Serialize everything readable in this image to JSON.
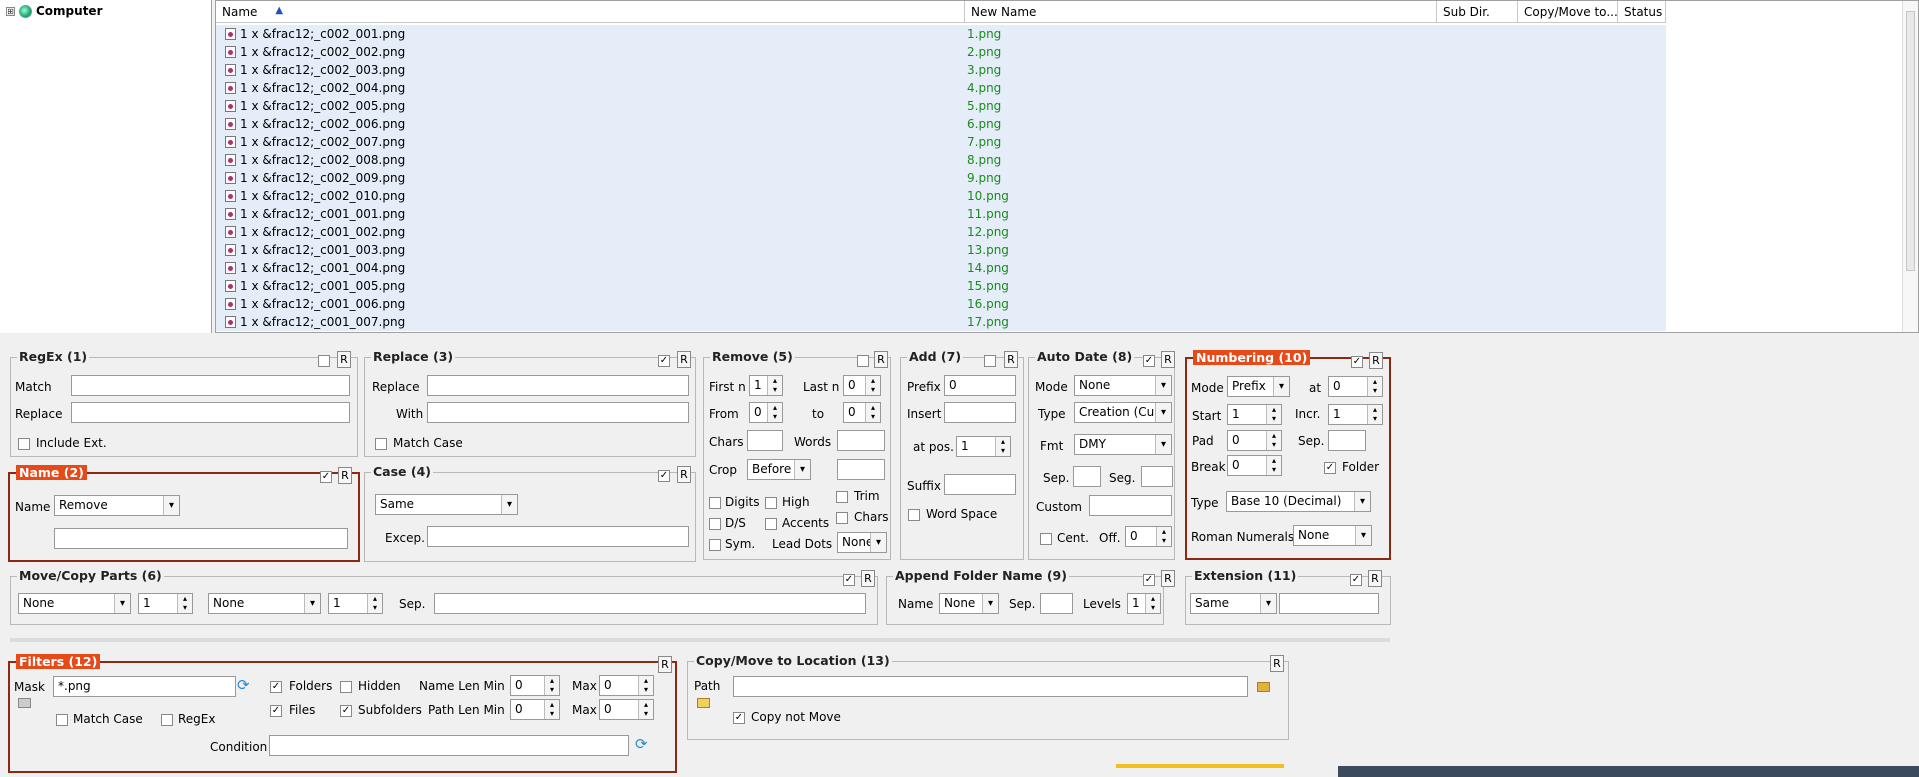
{
  "tree": {
    "root_label": "Computer",
    "expander": "⊞"
  },
  "columns": [
    "Name",
    "New Name",
    "Sub Dir.",
    "Copy/Move to...",
    "Status"
  ],
  "files": [
    {
      "name": "1 x &frac12;_c002_001.png",
      "new": "1.png"
    },
    {
      "name": "1 x &frac12;_c002_002.png",
      "new": "2.png"
    },
    {
      "name": "1 x &frac12;_c002_003.png",
      "new": "3.png"
    },
    {
      "name": "1 x &frac12;_c002_004.png",
      "new": "4.png"
    },
    {
      "name": "1 x &frac12;_c002_005.png",
      "new": "5.png"
    },
    {
      "name": "1 x &frac12;_c002_006.png",
      "new": "6.png"
    },
    {
      "name": "1 x &frac12;_c002_007.png",
      "new": "7.png"
    },
    {
      "name": "1 x &frac12;_c002_008.png",
      "new": "8.png"
    },
    {
      "name": "1 x &frac12;_c002_009.png",
      "new": "9.png"
    },
    {
      "name": "1 x &frac12;_c002_010.png",
      "new": "10.png"
    },
    {
      "name": "1 x &frac12;_c001_001.png",
      "new": "11.png"
    },
    {
      "name": "1 x &frac12;_c001_002.png",
      "new": "12.png"
    },
    {
      "name": "1 x &frac12;_c001_003.png",
      "new": "13.png"
    },
    {
      "name": "1 x &frac12;_c001_004.png",
      "new": "14.png"
    },
    {
      "name": "1 x &frac12;_c001_005.png",
      "new": "15.png"
    },
    {
      "name": "1 x &frac12;_c001_006.png",
      "new": "16.png"
    },
    {
      "name": "1 x &frac12;_c001_007.png",
      "new": "17.png"
    }
  ],
  "regex": {
    "title": "RegEx (1)",
    "match": "Match",
    "replace": "Replace",
    "include_ext": "Include Ext.",
    "r": "R"
  },
  "replace": {
    "title": "Replace (3)",
    "replace": "Replace",
    "with": "With",
    "match_case": "Match Case",
    "checked": "✓",
    "r": "R"
  },
  "remove": {
    "title": "Remove (5)",
    "first_n": "First n",
    "first_n_val": "1",
    "last_n": "Last n",
    "last_n_val": "0",
    "from": "From",
    "from_val": "0",
    "to": "to",
    "to_val": "0",
    "chars": "Chars",
    "words": "Words",
    "crop": "Crop",
    "crop_val": "Before",
    "digits": "Digits",
    "high": "High",
    "trim": "Trim",
    "ds": "D/S",
    "accents": "Accents",
    "chars2": "Chars",
    "sym": "Sym.",
    "lead_dots": "Lead Dots",
    "lead_dots_val": "None",
    "r": "R"
  },
  "add": {
    "title": "Add (7)",
    "prefix": "Prefix",
    "prefix_val": "0",
    "insert": "Insert",
    "at_pos": "at pos.",
    "at_pos_val": "1",
    "suffix": "Suffix",
    "word_space": "Word Space",
    "r": "R"
  },
  "autodate": {
    "title": "Auto Date (8)",
    "mode": "Mode",
    "mode_val": "None",
    "type": "Type",
    "type_val": "Creation (Cur",
    "fmt": "Fmt",
    "fmt_val": "DMY",
    "sep": "Sep.",
    "seg": "Seg.",
    "custom": "Custom",
    "cent": "Cent.",
    "off": "Off.",
    "off_val": "0",
    "checked": "✓",
    "r": "R"
  },
  "numbering": {
    "title": "Numbering (10)",
    "mode": "Mode",
    "mode_val": "Prefix",
    "at": "at",
    "at_val": "0",
    "start": "Start",
    "start_val": "1",
    "incr": "Incr.",
    "incr_val": "1",
    "pad": "Pad",
    "pad_val": "0",
    "sep": "Sep.",
    "break": "Break",
    "break_val": "0",
    "folder": "Folder",
    "type": "Type",
    "type_val": "Base 10 (Decimal)",
    "roman": "Roman Numerals",
    "roman_val": "None",
    "checked": "✓",
    "r": "R"
  },
  "name": {
    "title": "Name (2)",
    "name": "Name",
    "name_val": "Remove",
    "checked": "✓",
    "r": "R"
  },
  "case": {
    "title": "Case (4)",
    "case_val": "Same",
    "excep": "Excep.",
    "checked": "✓",
    "r": "R"
  },
  "movecopy": {
    "title": "Move/Copy Parts (6)",
    "dd1": "None",
    "n1": "1",
    "dd2": "None",
    "n2": "1",
    "sep": "Sep.",
    "checked": "✓",
    "r": "R"
  },
  "appendfolder": {
    "title": "Append Folder Name (9)",
    "name": "Name",
    "name_val": "None",
    "sep": "Sep.",
    "levels": "Levels",
    "levels_val": "1",
    "checked": "✓",
    "r": "R"
  },
  "extension": {
    "title": "Extension (11)",
    "ext_val": "Same",
    "checked": "✓",
    "r": "R"
  },
  "filters": {
    "title": "Filters (12)",
    "mask": "Mask",
    "mask_val": "*.png",
    "folders": "Folders",
    "hidden": "Hidden",
    "files": "Files",
    "subfolders": "Subfolders",
    "name_len_min": "Name Len Min",
    "name_len_min_val": "0",
    "max": "Max",
    "max_val": "0",
    "path_len_min": "Path Len Min",
    "path_len_min_val": "0",
    "max2": "Max",
    "max2_val": "0",
    "match_case": "Match Case",
    "regex": "RegEx",
    "condition": "Condition",
    "checked": "✓",
    "r": "R"
  },
  "copymove": {
    "title": "Copy/Move to Location (13)",
    "path": "Path",
    "copy_not_move": "Copy not Move",
    "checked": "✓",
    "r": "R"
  }
}
